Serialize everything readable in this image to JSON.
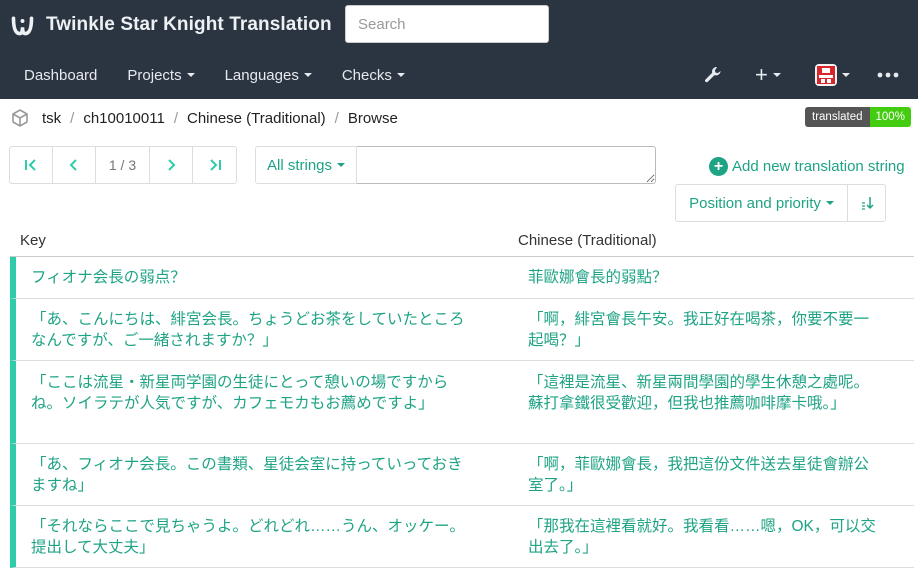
{
  "app": {
    "title": "Twinkle Star Knight Translation",
    "search_placeholder": "Search",
    "logo_icon": "weblate-logo-icon"
  },
  "nav": {
    "items": [
      "Dashboard",
      "Projects",
      "Languages",
      "Checks"
    ],
    "right_icons": [
      "wrench-icon",
      "plus-icon",
      "avatar-icon",
      "more-icon"
    ]
  },
  "breadcrumb": [
    "tsk",
    "ch10010011",
    "Chinese (Traditional)",
    "Browse"
  ],
  "badge": {
    "label": "translated",
    "value": "100%"
  },
  "pager": {
    "page": "1 / 3"
  },
  "filter": {
    "label": "All strings",
    "query": ""
  },
  "add_new": "Add new translation string",
  "sort": {
    "label": "Position and priority"
  },
  "table": {
    "headers": {
      "key": "Key",
      "translation": "Chinese (Traditional)"
    },
    "rows": [
      {
        "key": "フィオナ会長の弱点？",
        "translation": "菲歐娜會長的弱點？"
      },
      {
        "key": "「あ、こんにちは、緋宮会長。ちょうどお茶をしていたところなんですが、ご一緒されますか？」",
        "translation": "「啊，緋宮會長午安。我正好在喝茶，你要不要一起喝？」"
      },
      {
        "key": "「ここは流星・新星両学園の生徒にとって憩いの場ですからね。ソイラテが人気ですが、カフェモカもお薦めですよ」",
        "translation": "「這裡是流星、新星兩間學園的學生休憩之處呢。蘇打拿鐵很受歡迎，但我也推薦咖啡摩卡哦。」"
      },
      {
        "key": "「あ、フィオナ会長。この書類、星徒会室に持っていっておきますね」",
        "translation": "「啊，菲歐娜會長，我把這份文件送去星徒會辦公室了。」"
      },
      {
        "key": "「それならここで見ちゃうよ。どれどれ……うん、オッケー。提出して大丈夫」",
        "translation": "「那我在這裡看就好。我看看……嗯，OK，可以交出去了。」"
      }
    ]
  },
  "colors": {
    "navbar": "#2b3441",
    "accent": "#2eccaa",
    "link": "#1fa385",
    "badge_ok": "#44cc11"
  }
}
